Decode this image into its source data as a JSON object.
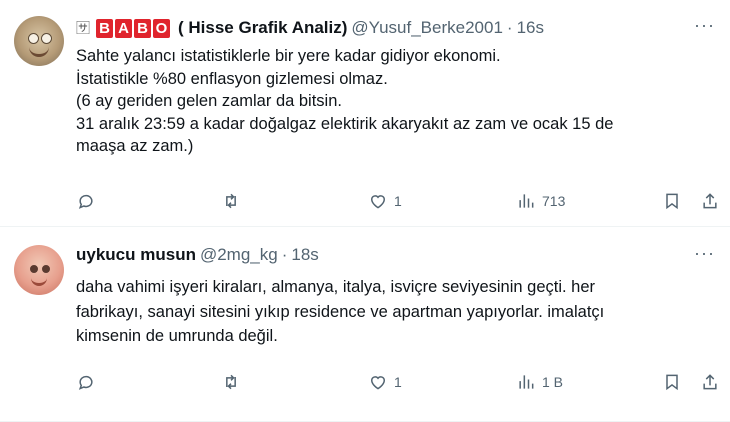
{
  "tweets": [
    {
      "name_emoji": "🈂",
      "name_tiles": [
        "B",
        "A",
        "B",
        "O"
      ],
      "name": "( Hisse Grafik Analiz)",
      "handle": "@Yusuf_Berke2001",
      "separator": "·",
      "time": "16s",
      "lines": [
        "Sahte yalancı istatistiklerle bir yere kadar gidiyor ekonomi.",
        "İstatistikle %80 enflasyon gizlemesi olmaz.",
        "(6 ay geriden gelen zamlar da bitsin.",
        "31 aralık 23:59 a kadar doğalgaz elektirik akaryakıt az zam ve ocak 15 de",
        "maaşa az zam.)"
      ],
      "stats": {
        "reply": "",
        "retweet": "",
        "like": "1",
        "views": "713"
      }
    },
    {
      "name": "uykucu musun",
      "handle": "@2mg_kg",
      "separator": "·",
      "time": "18s",
      "lines": [
        "daha vahimi işyeri kiraları, almanya, italya, isviçre seviyesinin geçti.  her",
        "fabrikayı, sanayi sitesini yıkıp residence ve apartman yapıyorlar. imalatçı",
        "kimsenin de umrunda değil."
      ],
      "stats": {
        "reply": "",
        "retweet": "",
        "like": "1",
        "views": "1 B"
      }
    }
  ],
  "icons": [
    "reply-icon",
    "retweet-icon",
    "like-icon",
    "views-icon",
    "bookmark-icon",
    "share-icon",
    "more-icon"
  ]
}
